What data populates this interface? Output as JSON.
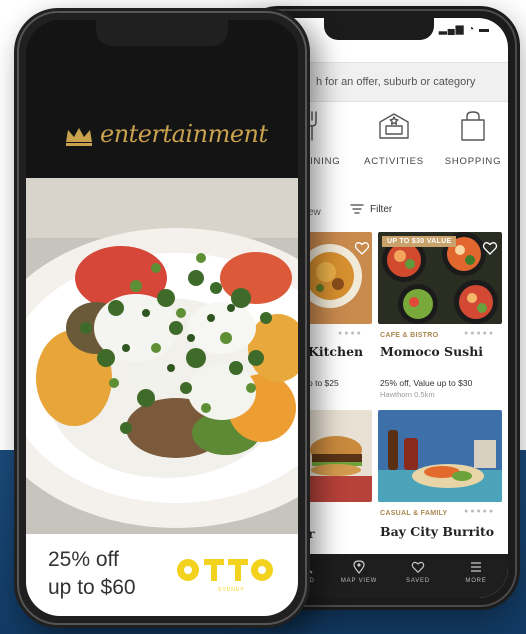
{
  "back_app": {
    "search_placeholder": "h for an offer, suburb or category",
    "status_icons": "▂▄▆ ◔ ▬",
    "categories": [
      {
        "label": ", DINING",
        "icon": "fork-knife-icon"
      },
      {
        "label": "ACTIVITIES",
        "icon": "ticket-icon"
      },
      {
        "label": "SHOPPING",
        "icon": "shopping-bag-icon"
      }
    ],
    "view_label": "ew",
    "filter_label": "Filter",
    "cards": [
      {
        "title": "Kitchen",
        "offer": "p to $25",
        "dots": "●●●●"
      },
      {
        "tag": "UP TO $30 VALUE",
        "category": "CAFE & BISTRO",
        "title": "Momoco Sushi",
        "offer": "25% off, Value up to $30",
        "location": "Hawthorn 0.5km",
        "dots": "●●●●●"
      },
      {
        "title": "r"
      },
      {
        "category": "CASUAL & FAMILY",
        "title": "Bay City Burrito",
        "dots": "●●●●●"
      }
    ],
    "nav": [
      {
        "label": "FIND",
        "icon": "search-icon"
      },
      {
        "label": "MAP VIEW",
        "icon": "map-pin-icon"
      },
      {
        "label": "SAVED",
        "icon": "heart-icon"
      },
      {
        "label": "MORE",
        "icon": "menu-icon"
      }
    ]
  },
  "front_app": {
    "brand": "entertainment",
    "promo_line1": "25% off",
    "promo_line2": "up to $60",
    "partner_logo": "OTTO",
    "partner_sub": "SYDNEY"
  },
  "colors": {
    "gold": "#c9a24e",
    "otto_yellow": "#f2d21c",
    "band_blue": "#1a4a7a"
  }
}
